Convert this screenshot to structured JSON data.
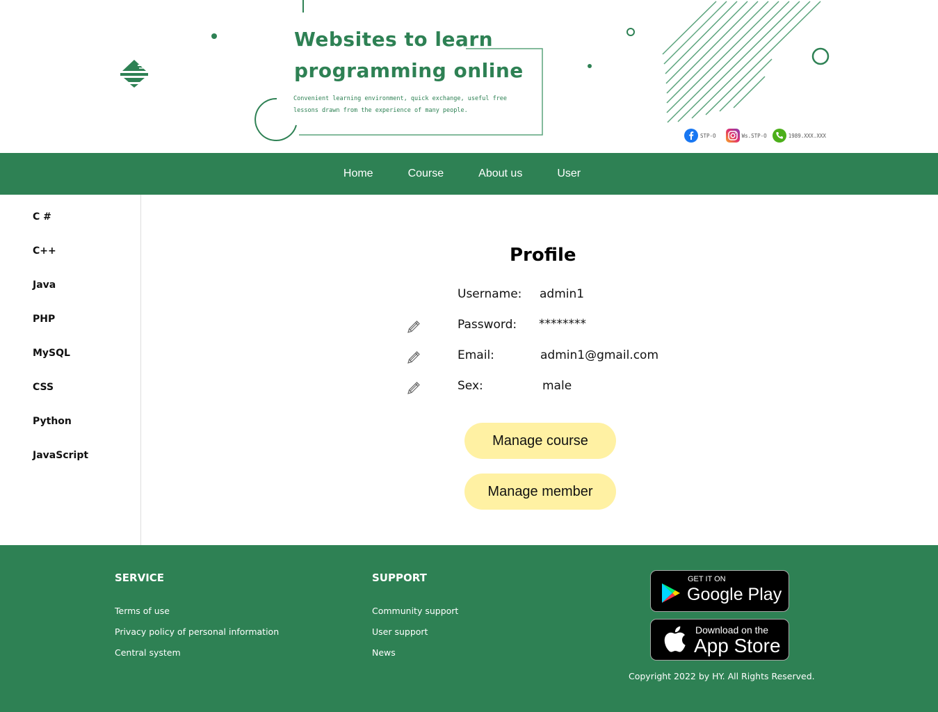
{
  "hero": {
    "title_line1": "Websites to learn",
    "title_line2": "programming online",
    "subtitle_line1": "Convenient learning environment, quick exchange, useful free",
    "subtitle_line2": "lessons drawn from the experience of many people."
  },
  "socials": [
    {
      "icon": "facebook-icon",
      "label": "STP-O"
    },
    {
      "icon": "instagram-icon",
      "label": "Ws.STP-O"
    },
    {
      "icon": "phone-icon",
      "label": "1989.XXX.XXX"
    }
  ],
  "nav": {
    "items": [
      {
        "label": "Home"
      },
      {
        "label": "Course"
      },
      {
        "label": "About us"
      },
      {
        "label": "User"
      }
    ]
  },
  "sidebar": {
    "items": [
      {
        "label": "C #"
      },
      {
        "label": "C++"
      },
      {
        "label": "Java"
      },
      {
        "label": "PHP"
      },
      {
        "label": "MySQL"
      },
      {
        "label": "CSS"
      },
      {
        "label": "Python"
      },
      {
        "label": "JavaScript"
      }
    ]
  },
  "profile": {
    "title": "Profile",
    "username_label": "Username:",
    "username_value": "admin1",
    "password_label": "Password:",
    "password_value": "********",
    "email_label": "Email:",
    "email_value": "admin1@gmail.com",
    "sex_label": "Sex:",
    "sex_value": "male",
    "manage_course_label": "Manage course",
    "manage_member_label": "Manage member"
  },
  "footer": {
    "service_heading": "SERVICE",
    "service_links": [
      "Terms of use",
      "Privacy policy of personal information",
      "Central system"
    ],
    "support_heading": "SUPPORT",
    "support_links": [
      "Community support",
      "User support",
      "News"
    ],
    "google_play_small": "GET IT ON",
    "google_play_big": "Google Play",
    "app_store_small": "Download on the",
    "app_store_big": "App Store",
    "copyright": "Copyright 2022 by HY. All Rights Reserved."
  },
  "colors": {
    "brand_green": "#2e8154",
    "button_yellow": "#fff1a3"
  }
}
